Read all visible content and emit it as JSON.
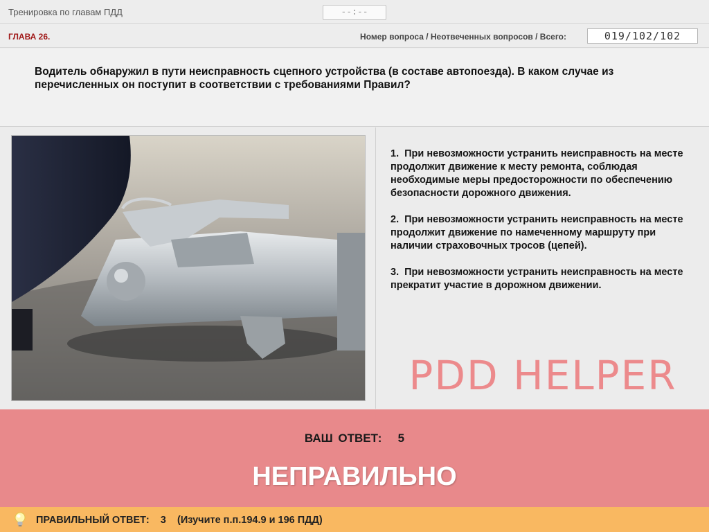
{
  "app": {
    "title": "Тренировка по главам ПДД",
    "timer": "--:--"
  },
  "chapter": {
    "label": "ГЛАВА 26.",
    "counter_label": "Номер вопроса / Неотвеченных вопросов / Всего:",
    "counter_value": "019/102/102"
  },
  "question": {
    "text": "Водитель обнаружил в пути неисправность сцепного устройства (в составе автопоезда). В каком случае из перечисленных он поступит в соответствии с требованиями Правил?",
    "image_alt": "Сцепное устройство (фаркоп) прицепа"
  },
  "answers": [
    {
      "num": "1.",
      "text": "При невозможности устранить неисправность на месте продолжит движение к месту ремонта, соблюдая необходимые меры предосторожности по обеспечению безопасности дорожного движения."
    },
    {
      "num": "2.",
      "text": "При невозможности устранить неисправность на месте продолжит движение по намеченному маршруту при наличии страховочных тросов (цепей)."
    },
    {
      "num": "3.",
      "text": "При невозможности устранить неисправность на месте прекратит участие в дорожном движении."
    }
  ],
  "logo": {
    "text": "PDD HELPER",
    "color": "#ec8a8c"
  },
  "result": {
    "your_answer_label": "ВАШ ОТВЕТ:",
    "your_answer_value": "5",
    "verdict": "НЕПРАВИЛЬНО",
    "background": "#e8898b"
  },
  "correct": {
    "label": "ПРАВИЛЬНЫЙ ОТВЕТ:",
    "value": "3",
    "hint": "(Изучите п.п.194.9 и 196 ПДД)",
    "background": "#f9b861"
  },
  "icons": {
    "hint": "lightbulb-icon"
  }
}
